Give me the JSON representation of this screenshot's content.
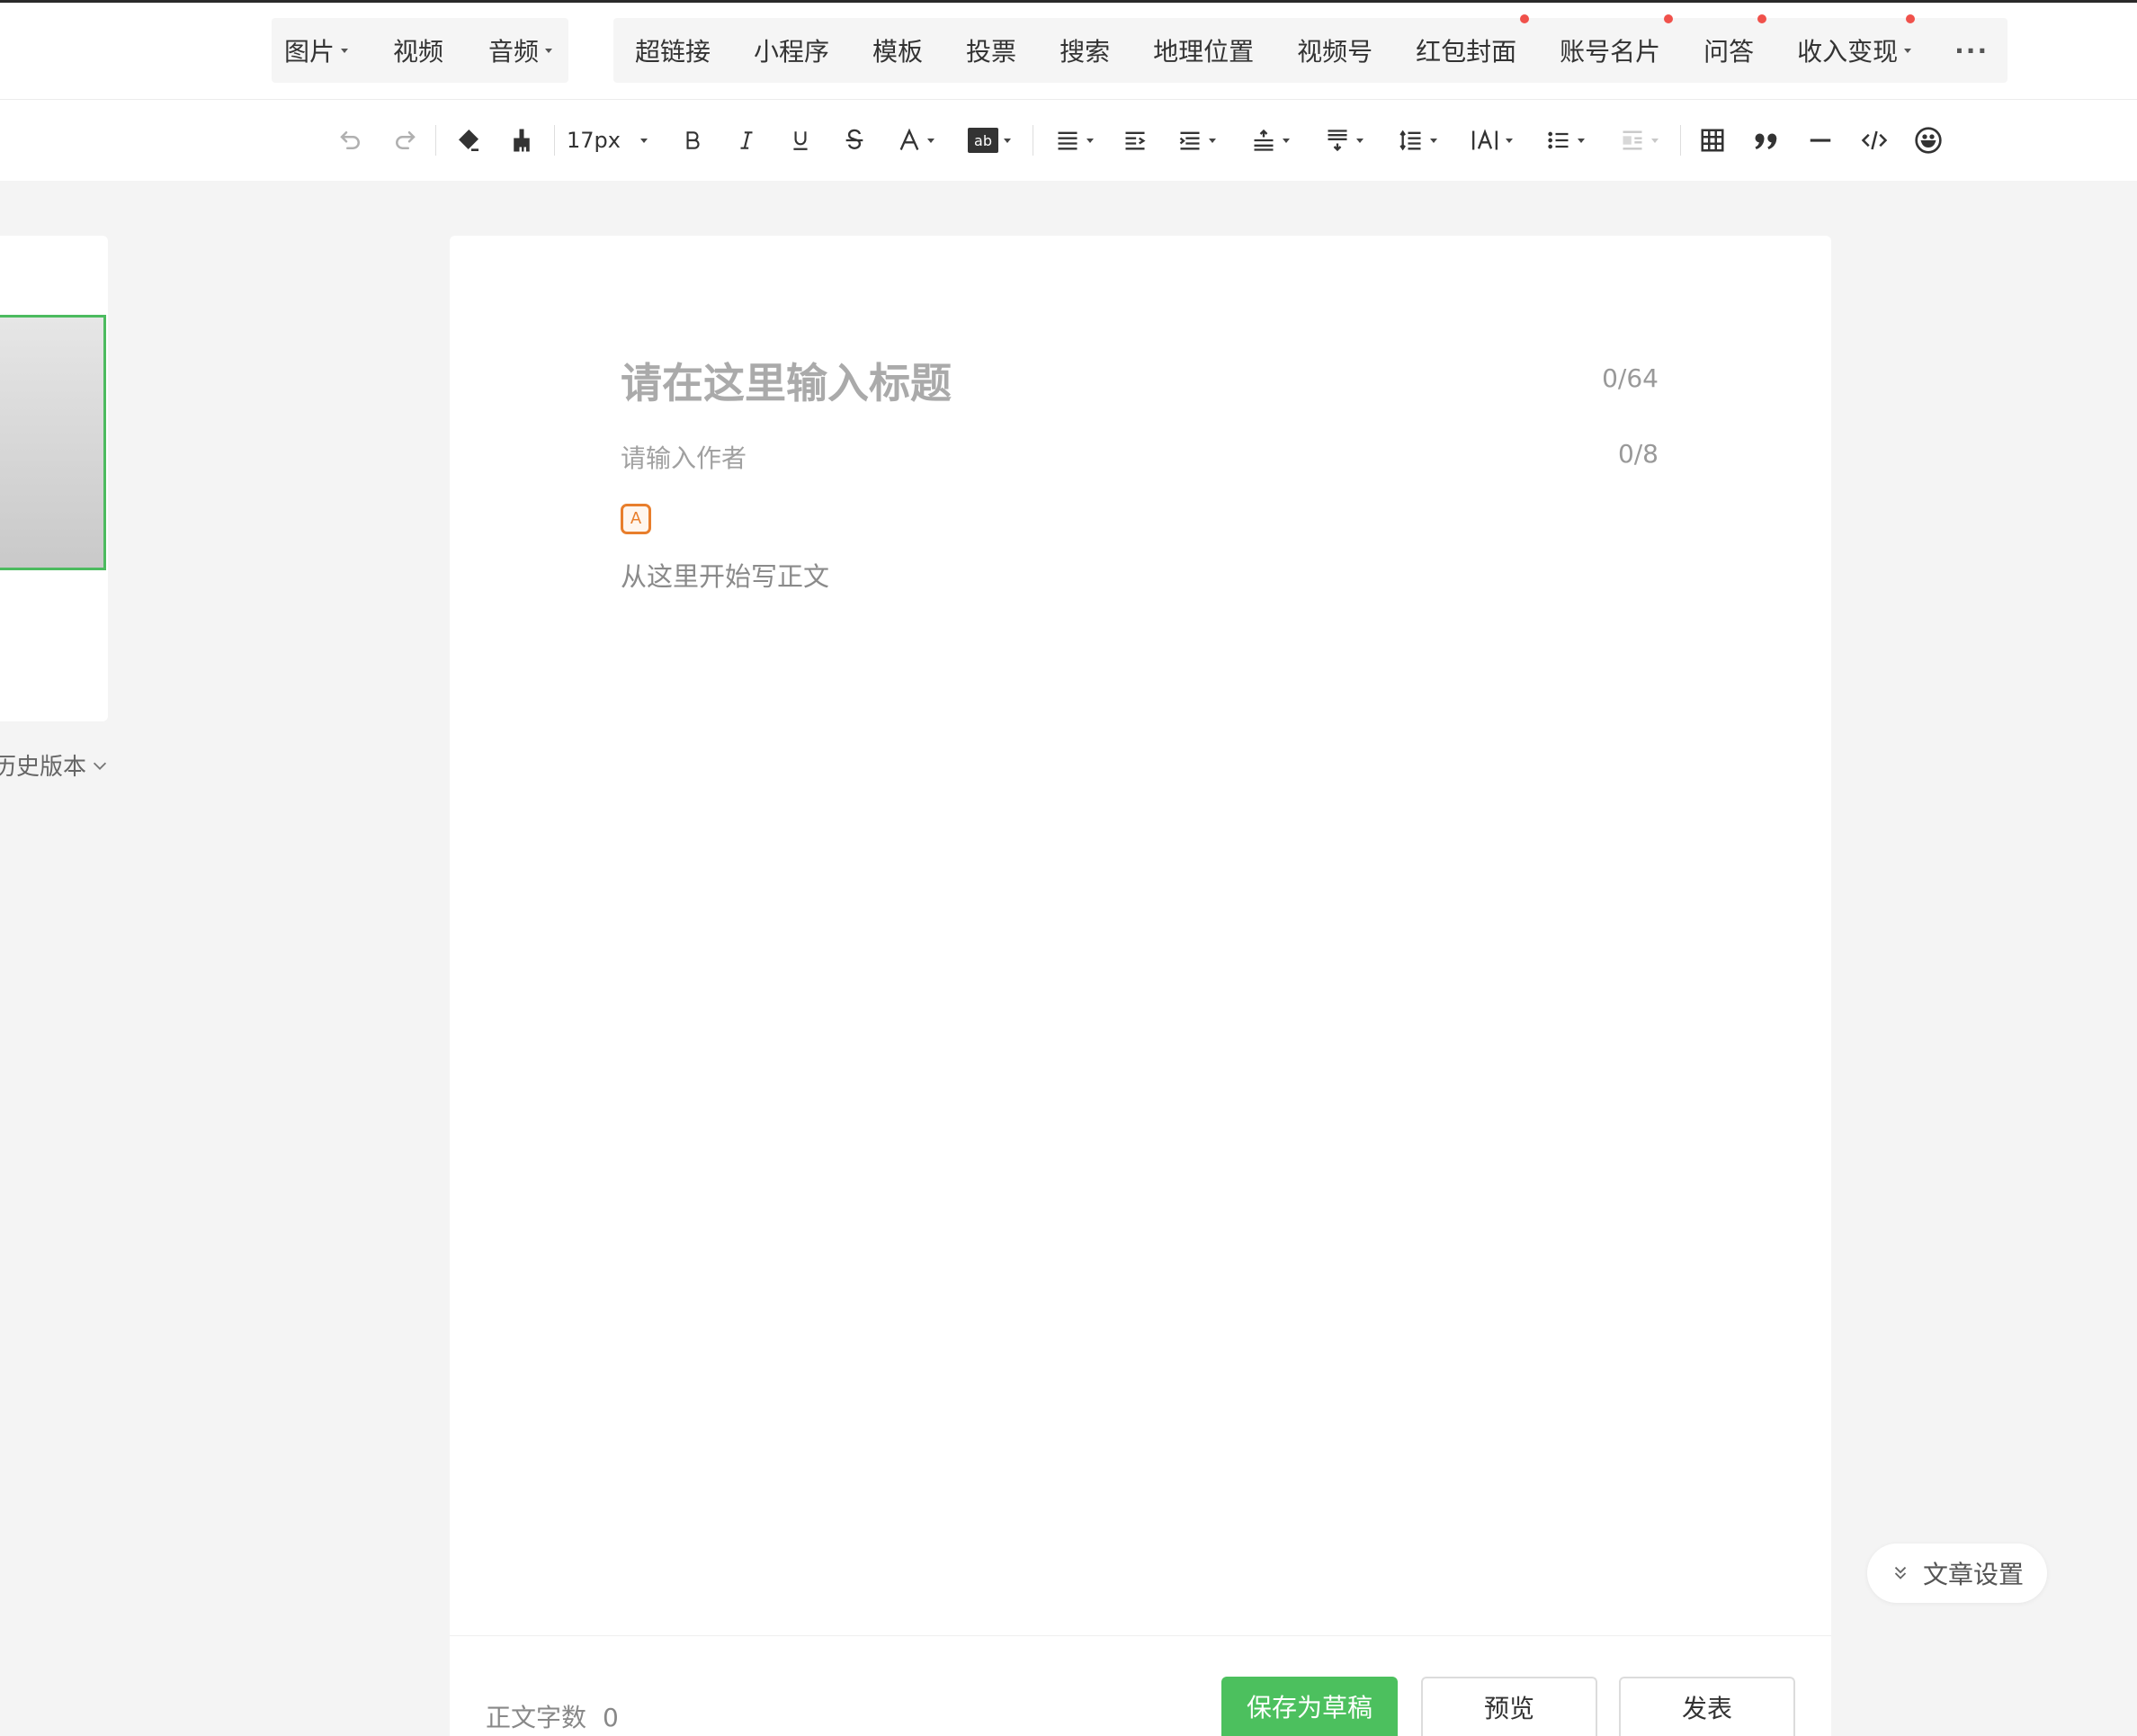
{
  "insert_bar": {
    "media_group": [
      {
        "label": "图片",
        "has_dropdown": true
      },
      {
        "label": "视频",
        "has_dropdown": false
      },
      {
        "label": "音频",
        "has_dropdown": true
      }
    ],
    "items": [
      {
        "label": "超链接",
        "badge": false
      },
      {
        "label": "小程序",
        "badge": false
      },
      {
        "label": "模板",
        "badge": false
      },
      {
        "label": "投票",
        "badge": false
      },
      {
        "label": "搜索",
        "badge": false
      },
      {
        "label": "地理位置",
        "badge": false
      },
      {
        "label": "视频号",
        "badge": false
      },
      {
        "label": "红包封面",
        "badge": true
      },
      {
        "label": "账号名片",
        "badge": true
      },
      {
        "label": "问答",
        "badge": true
      },
      {
        "label": "收入变现",
        "badge": true,
        "has_dropdown": true
      }
    ],
    "more_label": "···"
  },
  "format_bar": {
    "font_size": "17px"
  },
  "left_panel": {
    "history_label": "历史版本"
  },
  "editor": {
    "title_placeholder": "请在这里输入标题",
    "title_count": "0/64",
    "author_placeholder": "请输入作者",
    "author_count": "0/8",
    "ai_icon_letter": "A",
    "body_placeholder": "从这里开始写正文"
  },
  "footer": {
    "word_count_label": "正文字数",
    "word_count_value": "0",
    "save_label": "保存为草稿",
    "preview_label": "预览",
    "publish_label": "发表"
  },
  "settings_label": "文章设置",
  "colors": {
    "accent_green": "#4cc05e",
    "badge_red": "#f0514b",
    "ai_orange": "#e87e2c"
  }
}
